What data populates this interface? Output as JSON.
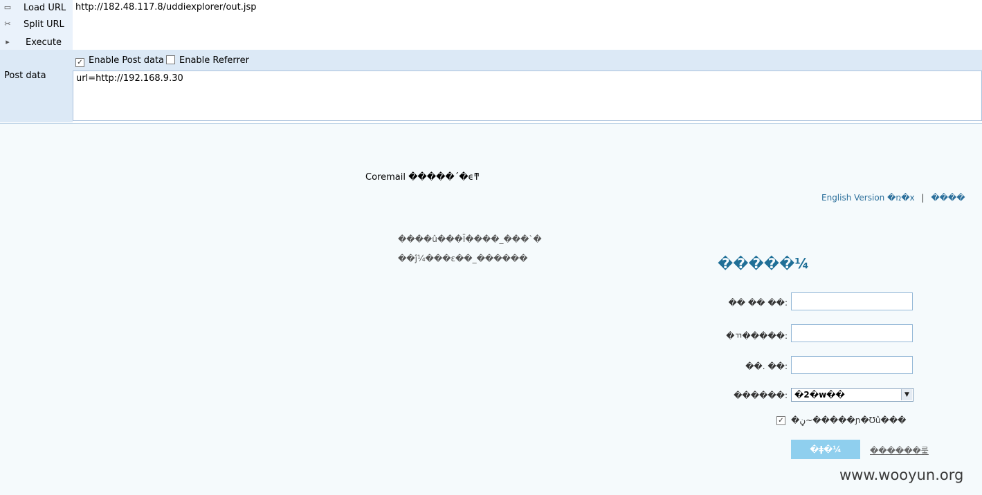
{
  "toolbar": {
    "load_url_label": "Load URL",
    "split_url_label": "Split URL",
    "execute_label": "Execute",
    "url_value": "http://182.48.117.8/uddiexplorer/out.jsp",
    "enable_post_label": "Enable Post data",
    "enable_post_checked": true,
    "enable_referrer_label": "Enable Referrer",
    "enable_referrer_checked": false,
    "post_data_label": "Post data",
    "post_data_value": "url=http://192.168.9.30"
  },
  "page": {
    "title": "Coremail �����΄�ϵͳ",
    "lang_english": "English Version",
    "lang_mid": "�ռ�x",
    "lang_separator": "|",
    "lang_other": "����",
    "intro_line1": "����û���Ī����_���`�",
    "intro_line2": "��ĵ¼���ε��_������",
    "login_heading": "�����¼",
    "username_label": "�� �� ��:",
    "domain_label": "�ㄲ�����:",
    "password_label": "��. ��:",
    "language_label": "������:",
    "language_selected": "�2�w��",
    "remember_label": "�ڼ~�����ɲ�Ʊû���",
    "remember_checked": true,
    "login_button_label": "�ǂ�¼",
    "forgot_link_label": "������룿",
    "watermark": "www.wooyun.org"
  }
}
